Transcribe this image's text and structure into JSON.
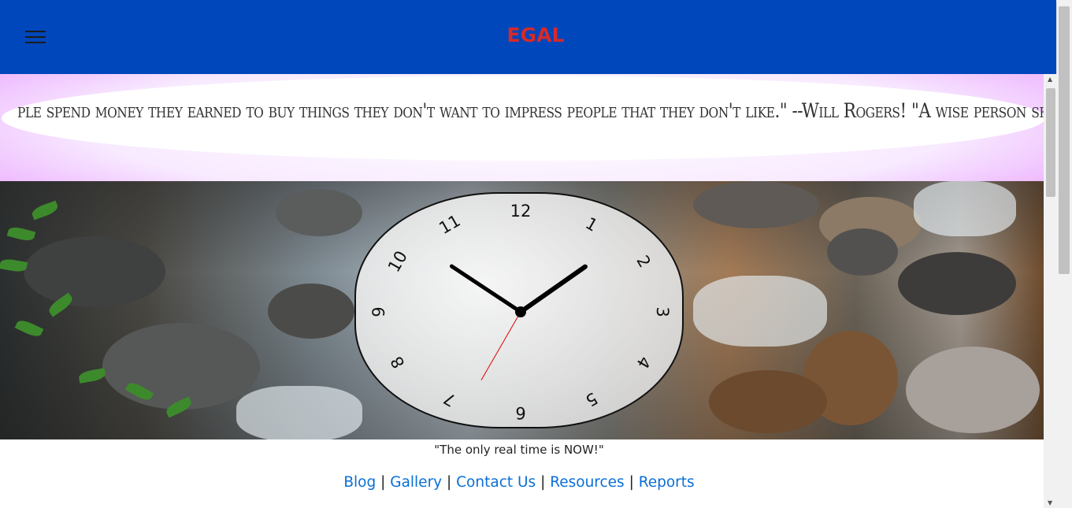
{
  "header": {
    "title": "EGAL",
    "menu_icon": "hamburger-menu-icon"
  },
  "marquee": {
    "text": "ple spend money they earned to buy things they don't want to impress people that they don't like.\" --Will Rogers! \"A wise person should have r"
  },
  "clock": {
    "numbers": [
      "12",
      "1",
      "2",
      "3",
      "4",
      "5",
      "6",
      "7",
      "8",
      "9",
      "10",
      "11"
    ],
    "time": {
      "hour": 1,
      "minute": 50,
      "second": 35
    }
  },
  "tagline": "\"The only real time is NOW!\"",
  "footer": {
    "links": [
      "Blog",
      "Gallery",
      "Contact Us",
      "Resources",
      "Reports"
    ],
    "separator": "|"
  },
  "colors": {
    "header_bg": "#0047bb",
    "title": "#d62a2a",
    "link": "#0a6fd6",
    "second_hand": "#e00000"
  }
}
